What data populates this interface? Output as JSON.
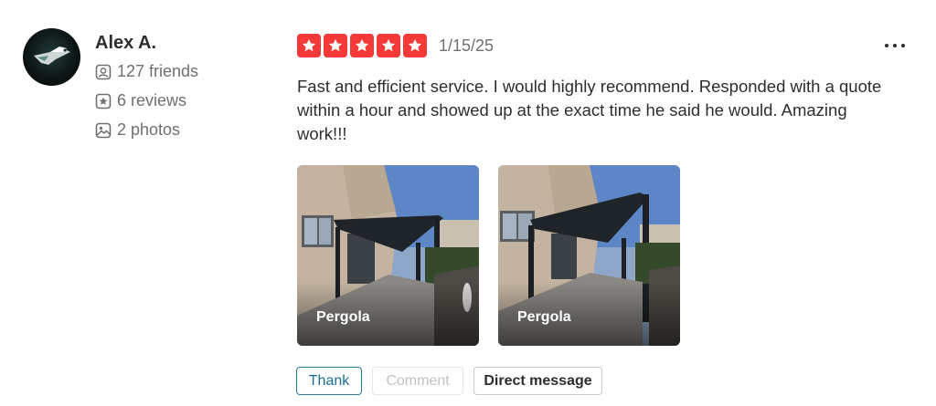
{
  "user": {
    "name": "Alex A.",
    "friends": "127 friends",
    "reviews": "6 reviews",
    "photos": "2 photos"
  },
  "review": {
    "rating": 5,
    "rating_max": 5,
    "date": "1/15/25",
    "text": "Fast and efficient service. I would highly recommend. Responded with a quote within a hour and showed up at the exact time he said he would. Amazing work!!!",
    "photos": [
      {
        "caption": "Pergola"
      },
      {
        "caption": "Pergola"
      }
    ]
  },
  "actions": {
    "thank": "Thank",
    "comment": "Comment",
    "direct_message": "Direct message"
  },
  "colors": {
    "star": "#f43939",
    "thank_border": "#2b7a9b",
    "text": "#2d2e2f",
    "muted": "#6e7072"
  },
  "icons": {
    "friends": "friends-icon",
    "reviews": "review-star-icon",
    "photos": "photo-icon",
    "more": "more-options-icon"
  }
}
